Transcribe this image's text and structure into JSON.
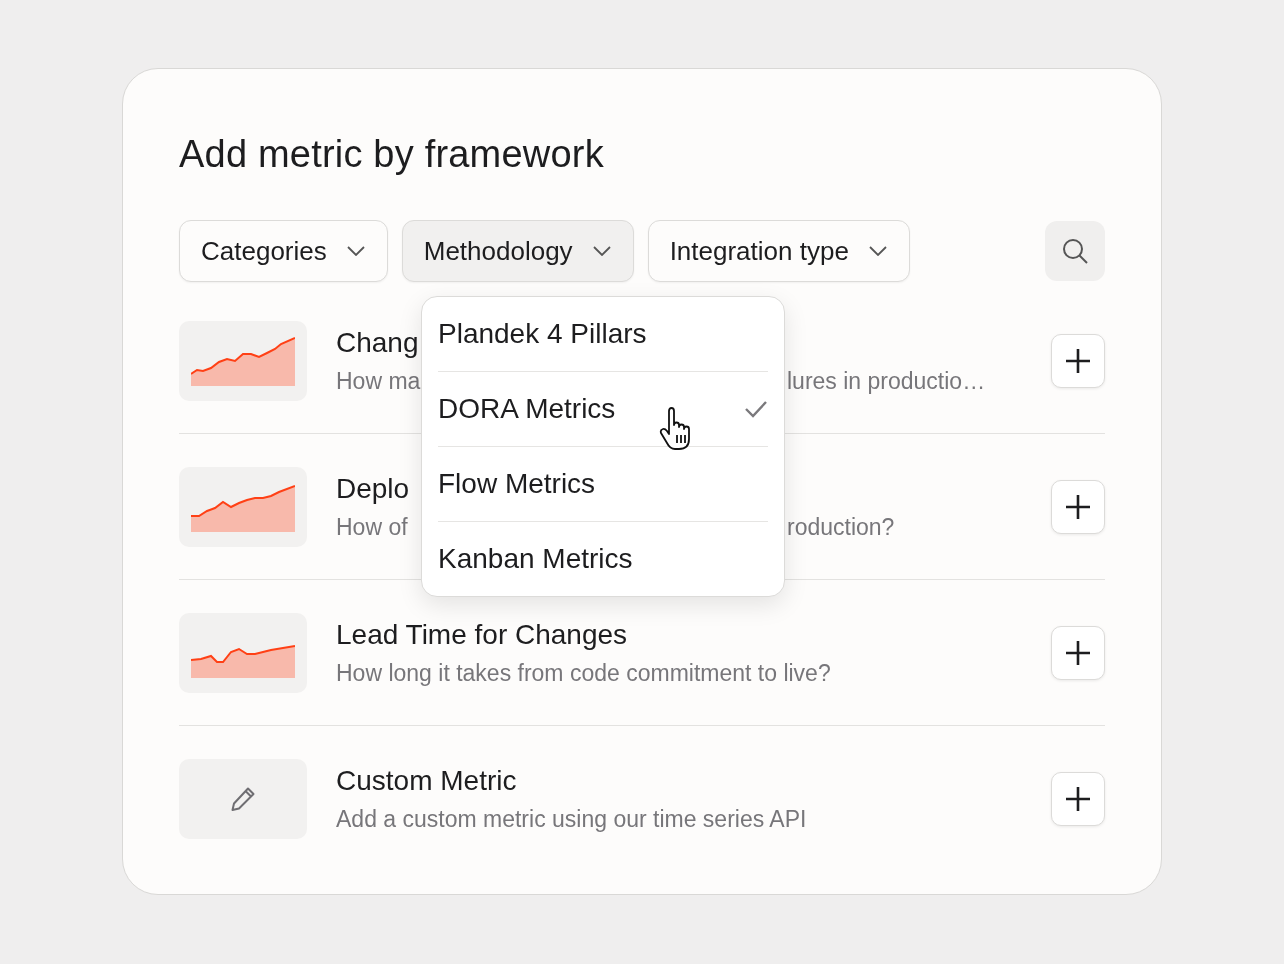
{
  "title": "Add metric by framework",
  "filters": [
    {
      "label": "Categories",
      "open": false
    },
    {
      "label": "Methodology",
      "open": true
    },
    {
      "label": "Integration type",
      "open": false
    }
  ],
  "dropdown": {
    "items": [
      {
        "label": "Plandek 4 Pillars",
        "selected": false
      },
      {
        "label": "DORA Metrics",
        "selected": true
      },
      {
        "label": "Flow Metrics",
        "selected": false
      },
      {
        "label": "Kanban Metrics",
        "selected": false
      }
    ]
  },
  "metrics": [
    {
      "kind": "chart",
      "title": "Chang",
      "description": "How ma",
      "description_end": "lures in productio…"
    },
    {
      "kind": "chart",
      "title": "Deplo",
      "description": "How of",
      "description_end": "roduction?"
    },
    {
      "kind": "chart",
      "title": "Lead Time for Changes",
      "description": "How long it takes from code commitment to live?"
    },
    {
      "kind": "custom",
      "title": "Custom Metric",
      "description": "Add a custom metric using our time series API"
    }
  ]
}
